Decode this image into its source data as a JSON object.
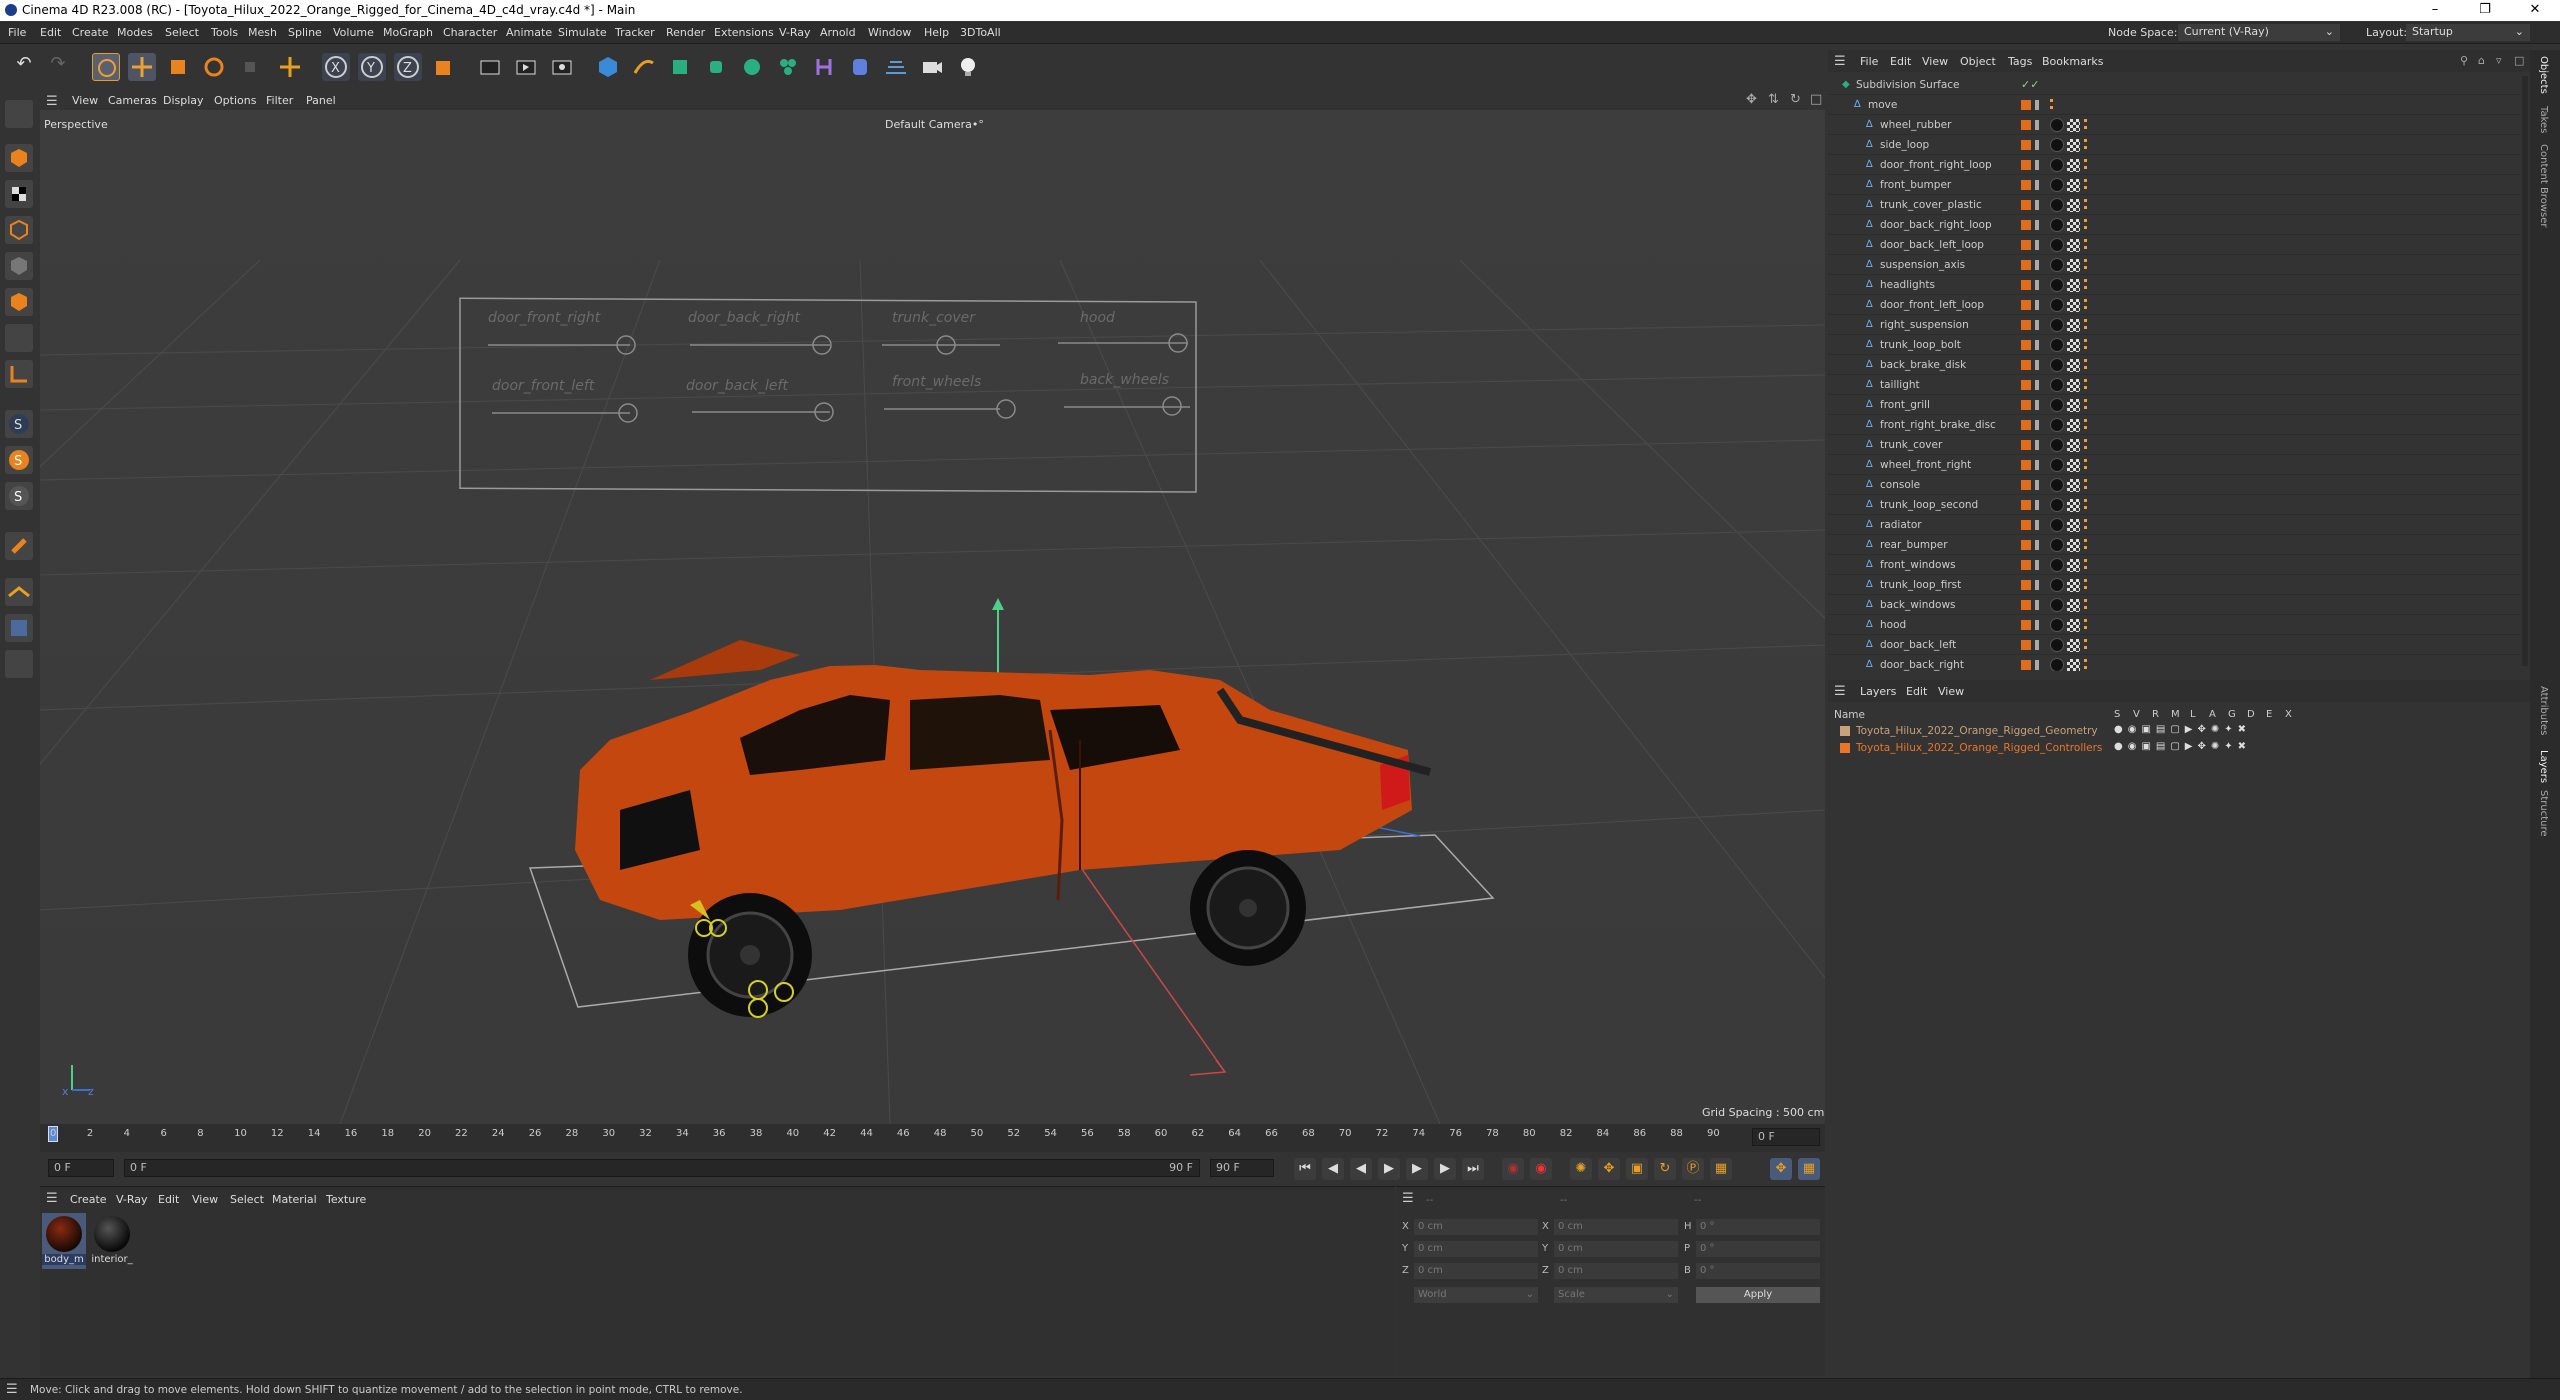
{
  "window": {
    "title": "Cinema 4D R23.008 (RC) - [Toyota_Hilux_2022_Orange_Rigged_for_Cinema_4D_c4d_vray.c4d *] - Main"
  },
  "menu": [
    "File",
    "Edit",
    "Create",
    "Modes",
    "Select",
    "Tools",
    "Mesh",
    "Spline",
    "Volume",
    "MoGraph",
    "Character",
    "Animate",
    "Simulate",
    "Tracker",
    "Render",
    "Extensions",
    "V-Ray",
    "Arnold",
    "Window",
    "Help",
    "3DToAll"
  ],
  "nodespace": {
    "label": "Node Space:",
    "value": "Current (V-Ray)"
  },
  "layout": {
    "label": "Layout:",
    "value": "Startup"
  },
  "viewport": {
    "menu": [
      "View",
      "Cameras",
      "Display",
      "Options",
      "Filter",
      "Panel"
    ],
    "name": "Perspective",
    "camera": "Default Camera",
    "camera_icon": "•°",
    "grid_spacing": "Grid Spacing : 500 cm",
    "controls_panel_labels": [
      "door_front_right",
      "door_back_right",
      "door_front_left",
      "door_back_left",
      "trunk_cover",
      "front_wheels",
      "back_wheels",
      "hood"
    ]
  },
  "timeline": {
    "ticks": [
      "0",
      "2",
      "4",
      "6",
      "8",
      "10",
      "12",
      "14",
      "16",
      "18",
      "20",
      "22",
      "24",
      "26",
      "28",
      "30",
      "32",
      "34",
      "36",
      "38",
      "40",
      "42",
      "44",
      "46",
      "48",
      "50",
      "52",
      "54",
      "56",
      "58",
      "60",
      "62",
      "64",
      "66",
      "68",
      "70",
      "72",
      "74",
      "76",
      "78",
      "80",
      "82",
      "84",
      "86",
      "88",
      "90"
    ],
    "frame_display": "0 F"
  },
  "transport": {
    "start": "0 F",
    "current": "0 F",
    "end_in": "90 F",
    "end": "90 F"
  },
  "materials": {
    "menu": [
      "Create",
      "V-Ray",
      "Edit",
      "View",
      "Select",
      "Material",
      "Texture"
    ],
    "items": [
      "body_m",
      "interior_"
    ]
  },
  "coords": {
    "x_label": "X",
    "y_label": "Y",
    "z_label": "Z",
    "h_label": "H",
    "p_label": "P",
    "b_label": "B",
    "pos_x": "0 cm",
    "pos_y": "0 cm",
    "pos_z": "0 cm",
    "size_x": "0 cm",
    "size_y": "0 cm",
    "size_z": "0 cm",
    "rot_h": "0 °",
    "rot_p": "0 °",
    "rot_b": "0 °",
    "mode": "World",
    "size_mode": "Scale",
    "apply": "Apply",
    "dashes": [
      "--",
      "--",
      "--"
    ]
  },
  "status": "Move: Click and drag to move elements. Hold down SHIFT to quantize movement / add to the selection in point mode, CTRL to remove.",
  "objects": {
    "menu": [
      "File",
      "Edit",
      "View",
      "Object",
      "Tags",
      "Bookmarks"
    ],
    "items": [
      "Subdivision Surface",
      "move",
      "wheel_rubber",
      "side_loop",
      "door_front_right_loop",
      "front_bumper",
      "trunk_cover_plastic",
      "door_back_right_loop",
      "door_back_left_loop",
      "suspension_axis",
      "headlights",
      "door_front_left_loop",
      "right_suspension",
      "trunk_loop_bolt",
      "back_brake_disk",
      "taillight",
      "front_grill",
      "front_right_brake_disc",
      "trunk_cover",
      "wheel_front_right",
      "console",
      "trunk_loop_second",
      "radiator",
      "rear_bumper",
      "front_windows",
      "trunk_loop_first",
      "back_windows",
      "hood",
      "door_back_left",
      "door_back_right"
    ]
  },
  "layers": {
    "menu": [
      "Layers",
      "Edit",
      "View"
    ],
    "header_name": "Name",
    "header_flags": [
      "S",
      "V",
      "R",
      "M",
      "L",
      "A",
      "G",
      "D",
      "E",
      "X"
    ],
    "items": [
      "Toyota_Hilux_2022_Orange_Rigged_Geometry",
      "Toyota_Hilux_2022_Orange_Rigged_Controllers"
    ]
  },
  "side_tabs": [
    "Objects",
    "Takes",
    "Content Browser",
    "Attributes",
    "Layers",
    "Structure"
  ],
  "colors": {
    "accent": "#e06d1c",
    "car": "#c4470f",
    "layer_geo": "#c7a27a",
    "layer_ctrl": "#e8762a"
  }
}
